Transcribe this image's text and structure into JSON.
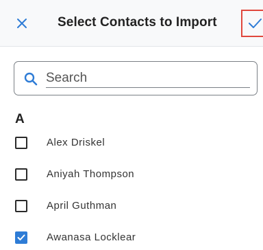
{
  "header": {
    "title": "Select Contacts to Import",
    "close_icon": "close-icon",
    "confirm_icon": "check-icon",
    "accent_color": "#2e7cd6",
    "highlight_color": "#e0473c"
  },
  "search": {
    "placeholder": "Search",
    "value": ""
  },
  "sections": [
    {
      "letter": "A",
      "contacts": [
        {
          "name": "Alex Driskel",
          "checked": false
        },
        {
          "name": "Aniyah Thompson",
          "checked": false
        },
        {
          "name": "April Guthman",
          "checked": false
        },
        {
          "name": "Awanasa Locklear",
          "checked": true
        }
      ]
    }
  ]
}
